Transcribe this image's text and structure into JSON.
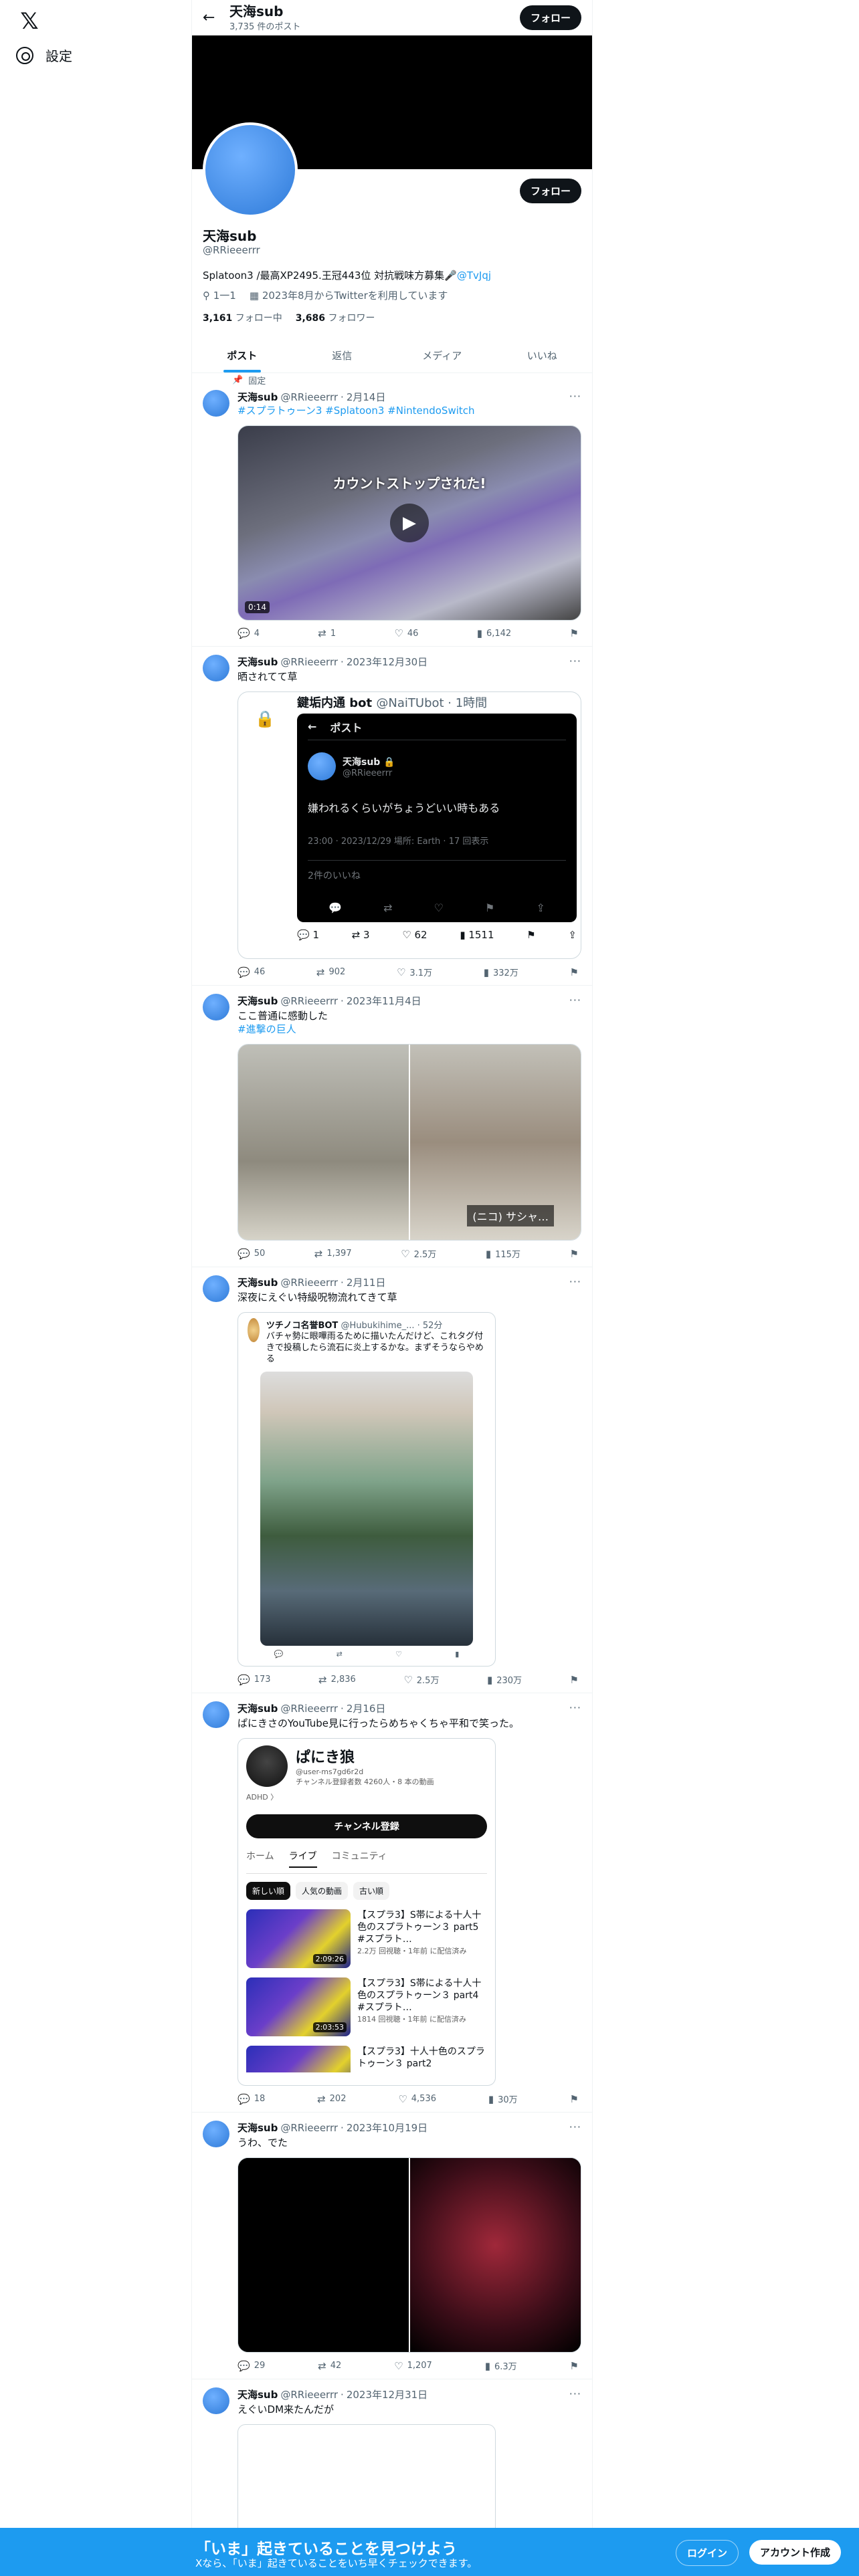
{
  "nav": {
    "logo": "𝕏",
    "settings_label": "設定"
  },
  "header": {
    "name": "天海sub",
    "post_count": "3,735 件のポスト",
    "follow_label": "フォロー"
  },
  "profile": {
    "name": "天海sub",
    "handle": "@RRieeerrr",
    "bio": "Splatoon3 /最高XP2495.王冠443位 対抗戦味方募集🎤",
    "bio_link": "@TvJqj",
    "location": "1一1",
    "joined": "2023年8月からTwitterを利用しています",
    "following_count": "3,161",
    "following_label": "フォロー中",
    "followers_count": "3,686",
    "followers_label": "フォロワー",
    "follow_label": "フォロー"
  },
  "tabs": [
    "ポスト",
    "返信",
    "メディア",
    "いいね"
  ],
  "pinned_label": "固定",
  "tweets": [
    {
      "name": "天海sub",
      "handle": "@RRieeerrr",
      "date": "2月14日",
      "text": "",
      "tags": "#スプラトゥーン3 #Splatoon3 #NintendoSwitch",
      "media_caption": "カウントストップされた!",
      "duration": "0:14",
      "reply": "4",
      "retweet": "1",
      "like": "46",
      "views": "6,142"
    },
    {
      "name": "天海sub",
      "handle": "@RRieeerrr",
      "date": "2023年12月30日",
      "text": "晒されてて草",
      "quote_name": "鍵垢内通 bot",
      "quote_handle": "@NaiTUbot · 1時間",
      "quote_bar": "ポスト",
      "inner_name": "天海sub 🔒",
      "inner_handle": "@RRieeerrr",
      "inner_text": "嫌われるくらいがちょうどいい時もある",
      "inner_meta": "23:00 · 2023/12/29 場所: Earth · 17 回表示",
      "inner_likes": "2件のいいね",
      "q_reply": "1",
      "q_retweet": "3",
      "q_like": "62",
      "q_views": "1511",
      "reply": "46",
      "retweet": "902",
      "like": "3.1万",
      "views": "332万"
    },
    {
      "name": "天海sub",
      "handle": "@RRieeerrr",
      "date": "2023年11月4日",
      "text": "ここ普通に感動した",
      "tags": "#進撃の巨人",
      "subtitle": "(ニコ) サシャ…",
      "reply": "50",
      "retweet": "1,397",
      "like": "2.5万",
      "views": "115万"
    },
    {
      "name": "天海sub",
      "handle": "@RRieeerrr",
      "date": "2月11日",
      "text": "深夜にえぐい特級呪物流れてきて草",
      "q_name": "ツチノコ名誉BOT",
      "q_handle": "@Hubukihime_... · 52分",
      "q_text": "バチャ勢に眼嗶雨るために描いたんだけど、これタグ付きで投稿したら流石に炎上するかな。まずそうならやめる",
      "reply": "173",
      "retweet": "2,836",
      "like": "2.5万",
      "views": "230万"
    },
    {
      "name": "天海sub",
      "handle": "@RRieeerrr",
      "date": "2月16日",
      "text": "ぱにきさのYouTube見に行ったらめちゃくちゃ平和で笑った。",
      "yt_name": "ぱにき狼",
      "yt_id": "@user-ms7gd6r2d",
      "yt_stats": "チャンネル登録者数 4260人・8 本の動画",
      "yt_more": "ADHD 〉",
      "yt_sub": "チャンネル登録",
      "yt_tabs": [
        "ホーム",
        "ライブ",
        "コミュニティ"
      ],
      "yt_chips": [
        "新しい順",
        "人気の動画",
        "古い順"
      ],
      "yt_videos": [
        {
          "title": "【スプラ3】S帯による十人十色のスプラトゥーン３ part5 #スプラト…",
          "meta": "2.2万 回視聴・1年前 に配信済み",
          "dur": "2:09:26"
        },
        {
          "title": "【スプラ3】S帯による十人十色のスプラトゥーン３ part4 #スプラト…",
          "meta": "1814 回視聴・1年前 に配信済み",
          "dur": "2:03:53"
        },
        {
          "title": "【スプラ3】十人十色のスプラトゥーン３ part2",
          "meta": "",
          "dur": ""
        }
      ],
      "reply": "18",
      "retweet": "202",
      "like": "4,536",
      "views": "30万"
    },
    {
      "name": "天海sub",
      "handle": "@RRieeerrr",
      "date": "2023年10月19日",
      "text": "うわ、でた",
      "reply": "29",
      "retweet": "42",
      "like": "1,207",
      "views": "6.3万"
    },
    {
      "name": "天海sub",
      "handle": "@RRieeerrr",
      "date": "2023年12月31日",
      "text": "えぐいDM来たんだが"
    }
  ],
  "signup": {
    "title": "「いま」起きていることを見つけよう",
    "subtitle": "Xなら、「いま」起きていることをいち早くチェックできます。",
    "login": "ログイン",
    "create": "アカウント作成"
  }
}
